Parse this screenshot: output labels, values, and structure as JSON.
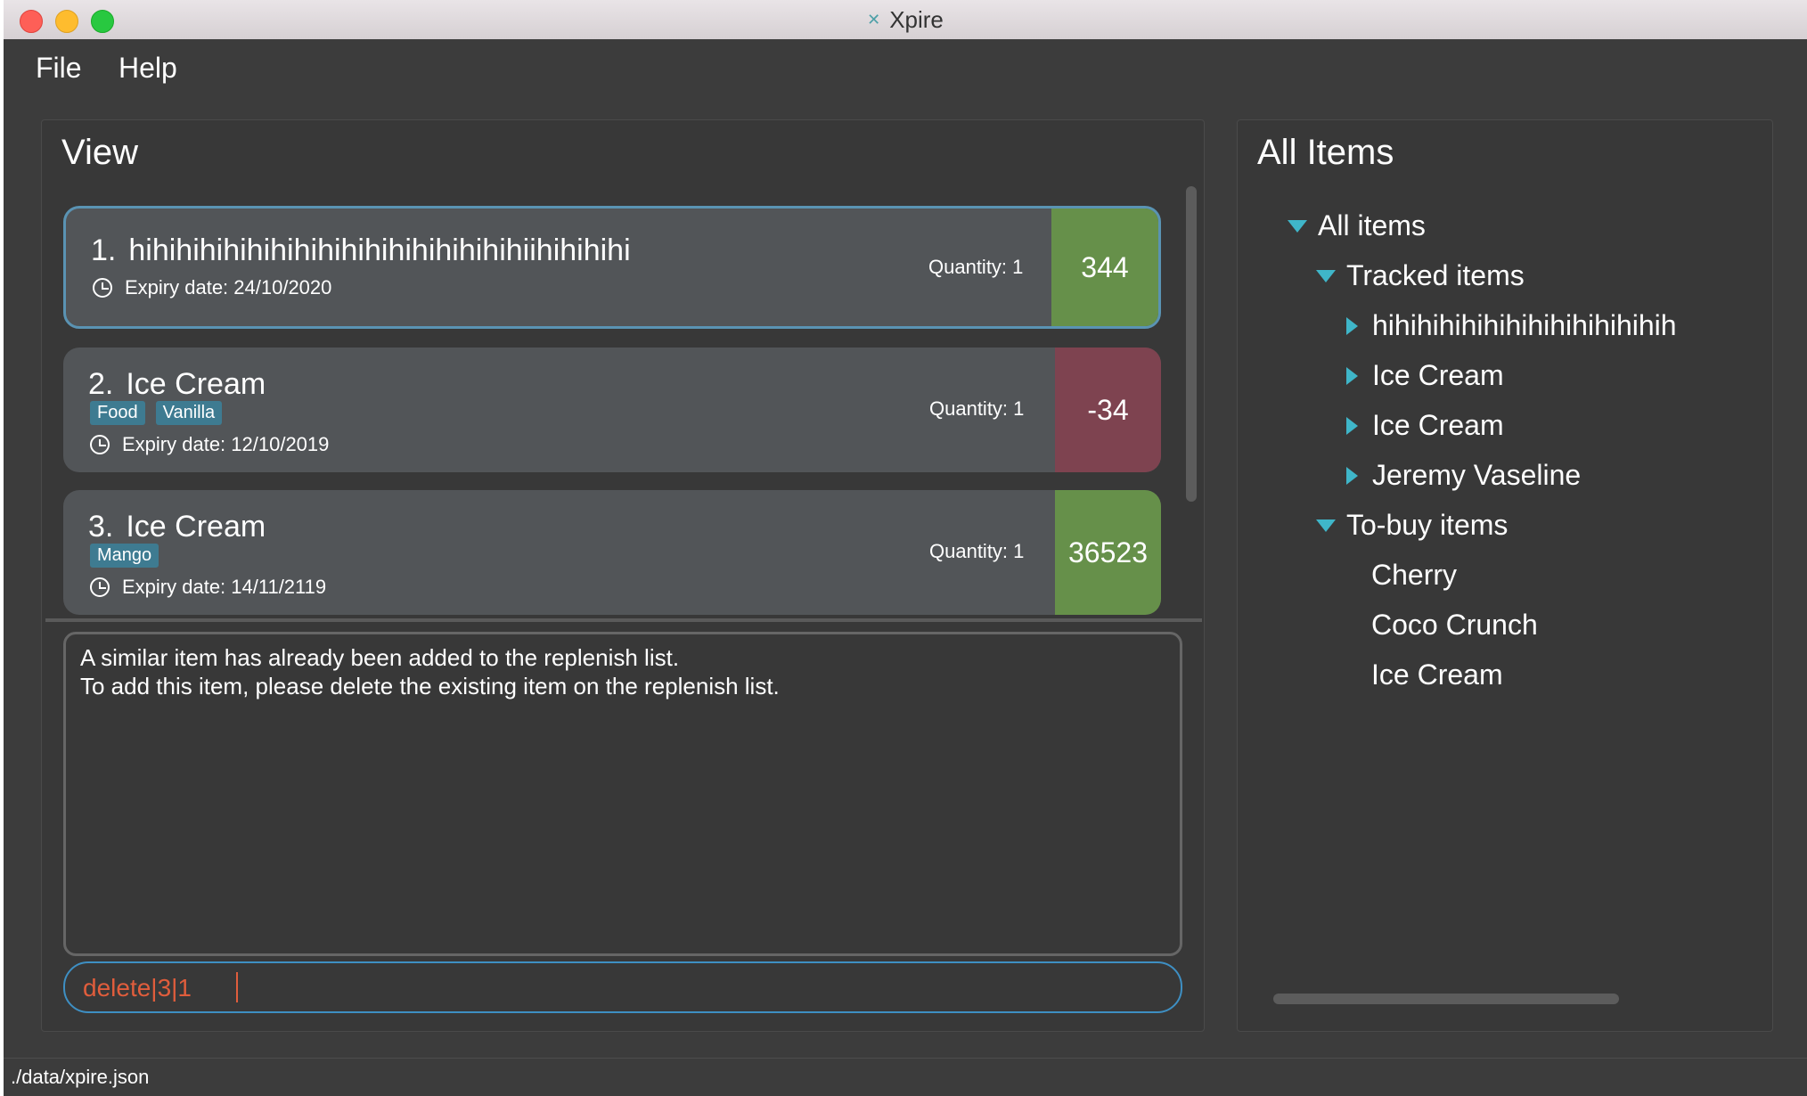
{
  "window": {
    "title": "Xpire"
  },
  "menu": {
    "file": "File",
    "help": "Help"
  },
  "view": {
    "title": "View",
    "items": [
      {
        "number": "1.",
        "name": "hihihihihihihihihihihihihihihihihiihihihihi",
        "tags": [],
        "expiry": "Expiry date: 24/10/2020",
        "quantity": "Quantity: 1",
        "days": "344",
        "status_color": "#66904a",
        "selected": true
      },
      {
        "number": "2.",
        "name": "Ice Cream",
        "tags": [
          "Food",
          "Vanilla"
        ],
        "expiry": "Expiry date: 12/10/2019",
        "quantity": "Quantity: 1",
        "days": "-34",
        "status_color": "#7e4350",
        "selected": false
      },
      {
        "number": "3.",
        "name": "Ice Cream",
        "tags": [
          "Mango"
        ],
        "expiry": "Expiry date: 14/11/2119",
        "quantity": "Quantity: 1",
        "days": "36523",
        "status_color": "#66904a",
        "selected": false
      }
    ]
  },
  "result": {
    "line1": "A similar item has already been added to the replenish list.",
    "line2": "To add this item, please delete the existing item on the replenish list."
  },
  "command": {
    "value": "delete|3|1"
  },
  "all_items": {
    "title": "All Items",
    "root": "All items",
    "tracked_label": "Tracked items",
    "tracked": [
      "hihihihihihihihihihihihihih",
      "Ice Cream",
      "Ice Cream",
      "Jeremy Vaseline"
    ],
    "tobuy_label": "To-buy items",
    "tobuy": [
      "Cherry",
      "Coco Crunch",
      "Ice Cream"
    ]
  },
  "status": {
    "path": "./data/xpire.json"
  }
}
